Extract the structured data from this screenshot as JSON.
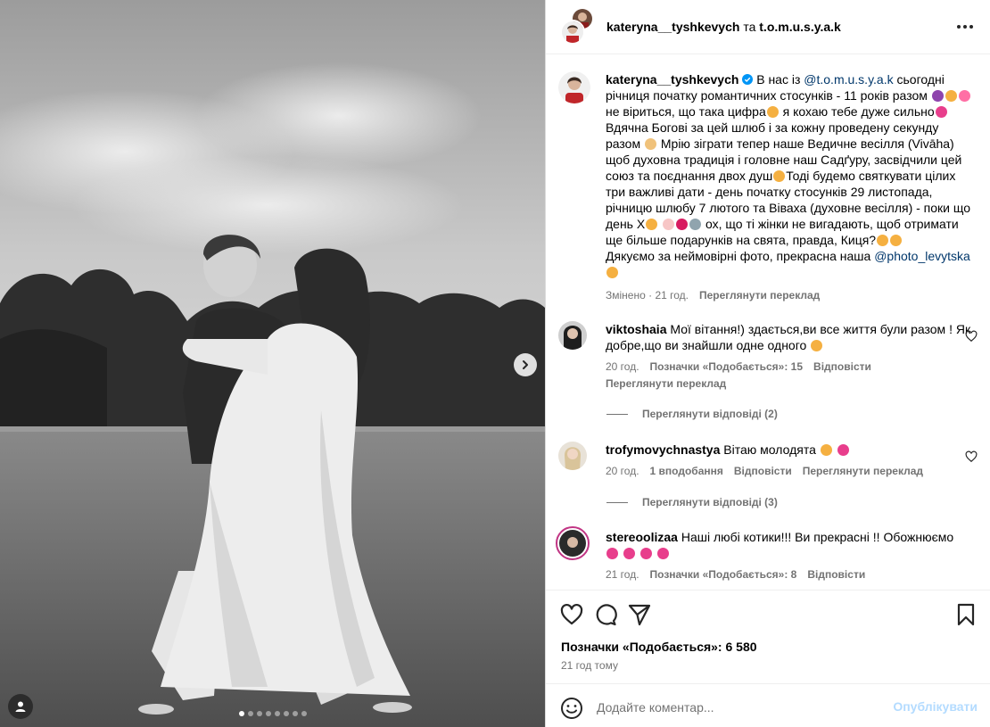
{
  "post": {
    "author": "kateryna__tyshkevych",
    "joiner": "та",
    "collaborator": "t.o.m.u.s.y.a.k",
    "slides_total": 8,
    "slide_active": 1
  },
  "caption": {
    "username": "kateryna__tyshkevych",
    "text_1": " В нас із ",
    "mention_1": "@t.o.m.u.s.y.a.k",
    "text_2": " сьогодні річниця початку романтичних стосунків - 11 років разом",
    "text_3": " не віриться, що така цифра",
    "text_4": " я кохаю тебе дуже сильно",
    "text_5": " Вдячна Богові за цей шлюб і за кожну проведену секунду разом ",
    "text_6": " Мрію зіграти тепер наше Ведичне весілля (Vivāha) щоб духовна традиція і головне наш Садґуру, засвідчили цей союз та поєднання двох душ",
    "text_7": "Тоді будемо святкувати цілих три важливі дати - день початку стосунків 29 листопада, річницю шлюбу 7 лютого та Віваха (духовне весілля) - поки що день Х",
    "text_8": " ох, що ті жінки не вигадають, щоб отримати ще більше подарунків на свята, правда, Киця?",
    "text_9": "Дякуємо за неймовірні фото, прекрасна наша ",
    "mention_2": "@photo_levytska",
    "edited": "Змінено",
    "time": "21 год.",
    "translate": "Переглянути переклад"
  },
  "comments": [
    {
      "username": "viktoshaia",
      "text": "Мої вітання!) здається,ви все життя були разом ! Як добре,що ви знайшли одне одного",
      "time": "20 год.",
      "likes": "Позначки «Подобається»: 15",
      "reply": "Відповісти",
      "translate": "Переглянути переклад",
      "view_replies": "Переглянути відповіді (2)"
    },
    {
      "username": "trofymovychnastya",
      "text": "Вітаю молодята",
      "time": "20 год.",
      "likes": "1 вподобання",
      "reply": "Відповісти",
      "translate": "Переглянути переклад",
      "view_replies": "Переглянути відповіді (3)"
    },
    {
      "username": "stereoolizaa",
      "text": "Наші любі котики!!! Ви прекрасні !! Обожнюємо",
      "time": "21 год.",
      "likes": "Позначки «Подобається»: 8",
      "reply": "Відповісти"
    }
  ],
  "footer": {
    "likes": "Позначки «Подобається»: 6 580",
    "time": "21 год тому",
    "comment_placeholder": "Додайте коментар...",
    "post_label": "Опублікувати"
  },
  "colors": {
    "link": "#00376b",
    "meta": "#737373",
    "post_button": "#b3dbff",
    "verified": "#0095f6",
    "story_ring": "#c13584"
  },
  "icons": [
    "chevron-right-icon",
    "user-tag-icon",
    "more-icon",
    "verified-icon",
    "heart-icon",
    "comment-icon",
    "share-icon",
    "bookmark-icon",
    "emoji-icon"
  ]
}
